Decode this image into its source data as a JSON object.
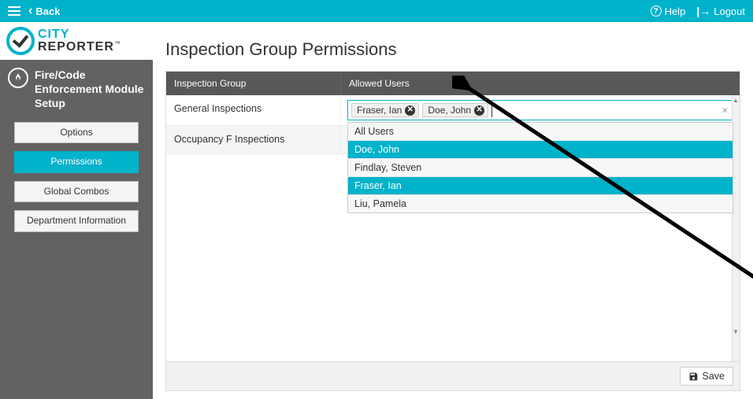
{
  "topbar": {
    "back": "Back",
    "help": "Help",
    "logout": "Logout"
  },
  "logo": {
    "line1": "CITY",
    "line2": "REPORTER",
    "tm": "™"
  },
  "module": {
    "title": "Fire/Code Enforcement Module Setup"
  },
  "sidebar": {
    "items": [
      {
        "label": "Options",
        "active": false
      },
      {
        "label": "Permissions",
        "active": true
      },
      {
        "label": "Global Combos",
        "active": false
      },
      {
        "label": "Department Information",
        "active": false
      }
    ]
  },
  "page": {
    "title": "Inspection Group Permissions"
  },
  "table": {
    "headers": {
      "group": "Inspection Group",
      "users": "Allowed Users"
    },
    "rows": [
      {
        "group": "General Inspections",
        "tokens": [
          "Fraser, Ian",
          "Doe, John"
        ],
        "dropdown": [
          {
            "label": "All Users",
            "selected": false
          },
          {
            "label": "Doe, John",
            "selected": true
          },
          {
            "label": "Findlay, Steven",
            "selected": false
          },
          {
            "label": "Fraser, Ian",
            "selected": true
          },
          {
            "label": "Liu, Pamela",
            "selected": false
          }
        ]
      },
      {
        "group": "Occupancy F Inspections",
        "tokens": [],
        "dropdown": []
      }
    ]
  },
  "footer": {
    "save": "Save"
  }
}
